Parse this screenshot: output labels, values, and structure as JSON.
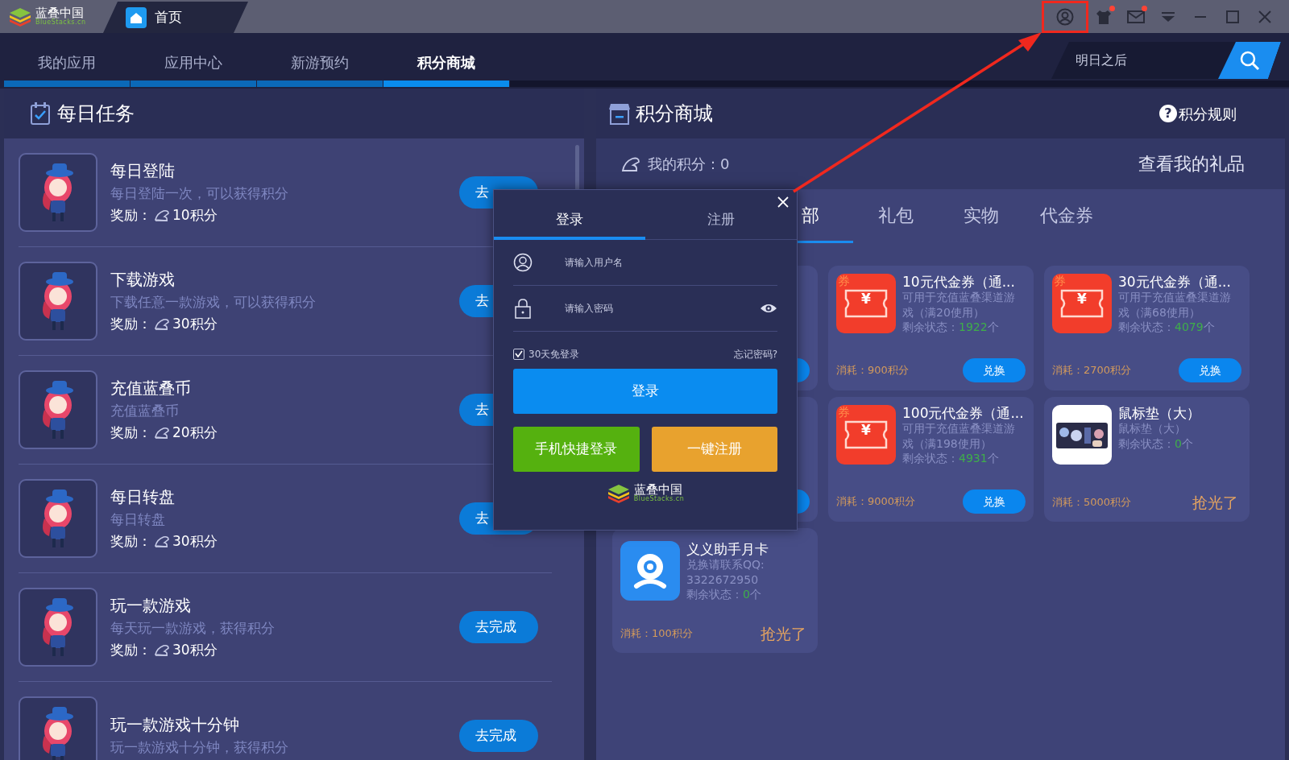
{
  "titlebar": {
    "logo_name": "蓝叠中国",
    "logo_sub": "BlueStacks.cn",
    "tab": "首页",
    "icons": [
      {
        "kind": "user",
        "badge": false,
        "highlighted": true
      },
      {
        "kind": "shirt",
        "badge": true,
        "highlighted": false
      },
      {
        "kind": "mail",
        "badge": true,
        "highlighted": false
      },
      {
        "kind": "dropdown",
        "badge": false,
        "highlighted": false
      }
    ]
  },
  "nav": {
    "tabs": [
      {
        "label": "我的应用",
        "selected": false
      },
      {
        "label": "应用中心",
        "selected": false
      },
      {
        "label": "新游预约",
        "selected": false
      },
      {
        "label": "积分商城",
        "selected": true
      }
    ],
    "search": {
      "placeholder": "明日之后"
    }
  },
  "tasks": {
    "title": "每日任务",
    "items": [
      {
        "name": "每日登陆",
        "desc": "每日登陆一次，可以获得积分",
        "reward_label": "奖励：",
        "reward": "10积分",
        "button": "去"
      },
      {
        "name": "下载游戏",
        "desc": "下载任意一款游戏，可以获得积分",
        "reward_label": "奖励：",
        "reward": "30积分",
        "button": "去"
      },
      {
        "name": "充值蓝叠币",
        "desc": "充值蓝叠币",
        "reward_label": "奖励：",
        "reward": "20积分",
        "button": "去"
      },
      {
        "name": "每日转盘",
        "desc": "每日转盘",
        "reward_label": "奖励：",
        "reward": "30积分",
        "button": "去"
      },
      {
        "name": "玩一款游戏",
        "desc": "每天玩一款游戏，获得积分",
        "reward_label": "奖励：",
        "reward": "30积分",
        "button": "去完成"
      },
      {
        "name": "玩一款游戏十分钟",
        "desc": "玩一款游戏十分钟，获得积分",
        "button": "去完成"
      }
    ]
  },
  "shop": {
    "title": "积分商城",
    "rules_icon": "?",
    "rules": "积分规则",
    "my_points": "我的积分：0",
    "my_gifts": "查看我的礼品",
    "tabs": [
      {
        "label": "部",
        "selected": true
      },
      {
        "label": "礼包",
        "selected": false
      },
      {
        "label": "实物",
        "selected": false
      },
      {
        "label": "代金券",
        "selected": false
      }
    ],
    "cards": [
      {
        "kind": "covered"
      },
      {
        "kind": "voucher",
        "stamp": "券",
        "glyph": "¥",
        "title": "10元代金券（通...",
        "desc": "可用于充值蓝叠渠道游戏（满20使用）",
        "stock_label": "剩余状态：",
        "stock": "1922",
        "unit": "个",
        "cost": "消耗：900积分",
        "action": "兑换",
        "sold_out": false
      },
      {
        "kind": "voucher",
        "stamp": "券",
        "glyph": "¥",
        "title": "30元代金券（通...",
        "desc": "可用于充值蓝叠渠道游戏（满68使用）",
        "stock_label": "剩余状态：",
        "stock": "4079",
        "unit": "个",
        "cost": "消耗：2700积分",
        "action": "兑换",
        "sold_out": false
      },
      {
        "kind": "covered"
      },
      {
        "kind": "voucher",
        "stamp": "券",
        "glyph": "¥",
        "title": "100元代金券（通...",
        "desc": "可用于充值蓝叠渠道游戏（满198使用）",
        "stock_label": "剩余状态：",
        "stock": "4931",
        "unit": "个",
        "cost": "消耗：9000积分",
        "action": "兑换",
        "sold_out": false
      },
      {
        "kind": "product",
        "title": "鼠标垫（大）",
        "desc": "鼠标垫（大）",
        "stock_label": "剩余状态：",
        "stock": "0",
        "unit": "个",
        "cost": "消耗：5000积分",
        "action": "抢光了",
        "sold_out": true
      },
      {
        "kind": "app",
        "title": "义义助手月卡",
        "desc": "兑换请联系QQ: 3322672950",
        "stock_label": "剩余状态：",
        "stock": "0",
        "unit": "个",
        "cost": "消耗：100积分",
        "action": "抢光了",
        "sold_out": true
      }
    ]
  },
  "login": {
    "tabs": [
      {
        "label": "登录",
        "selected": true
      },
      {
        "label": "注册",
        "selected": false
      }
    ],
    "username_placeholder": "请输入用户名",
    "password_placeholder": "请输入密码",
    "remember": {
      "label": "30天免登录",
      "checked": true
    },
    "forgot": "忘记密码?",
    "submit": "登录",
    "phone_login": "手机快捷登录",
    "quick_register": "一键注册",
    "logo_name": "蓝叠中国",
    "logo_sub": "BlueStacks.cn"
  }
}
